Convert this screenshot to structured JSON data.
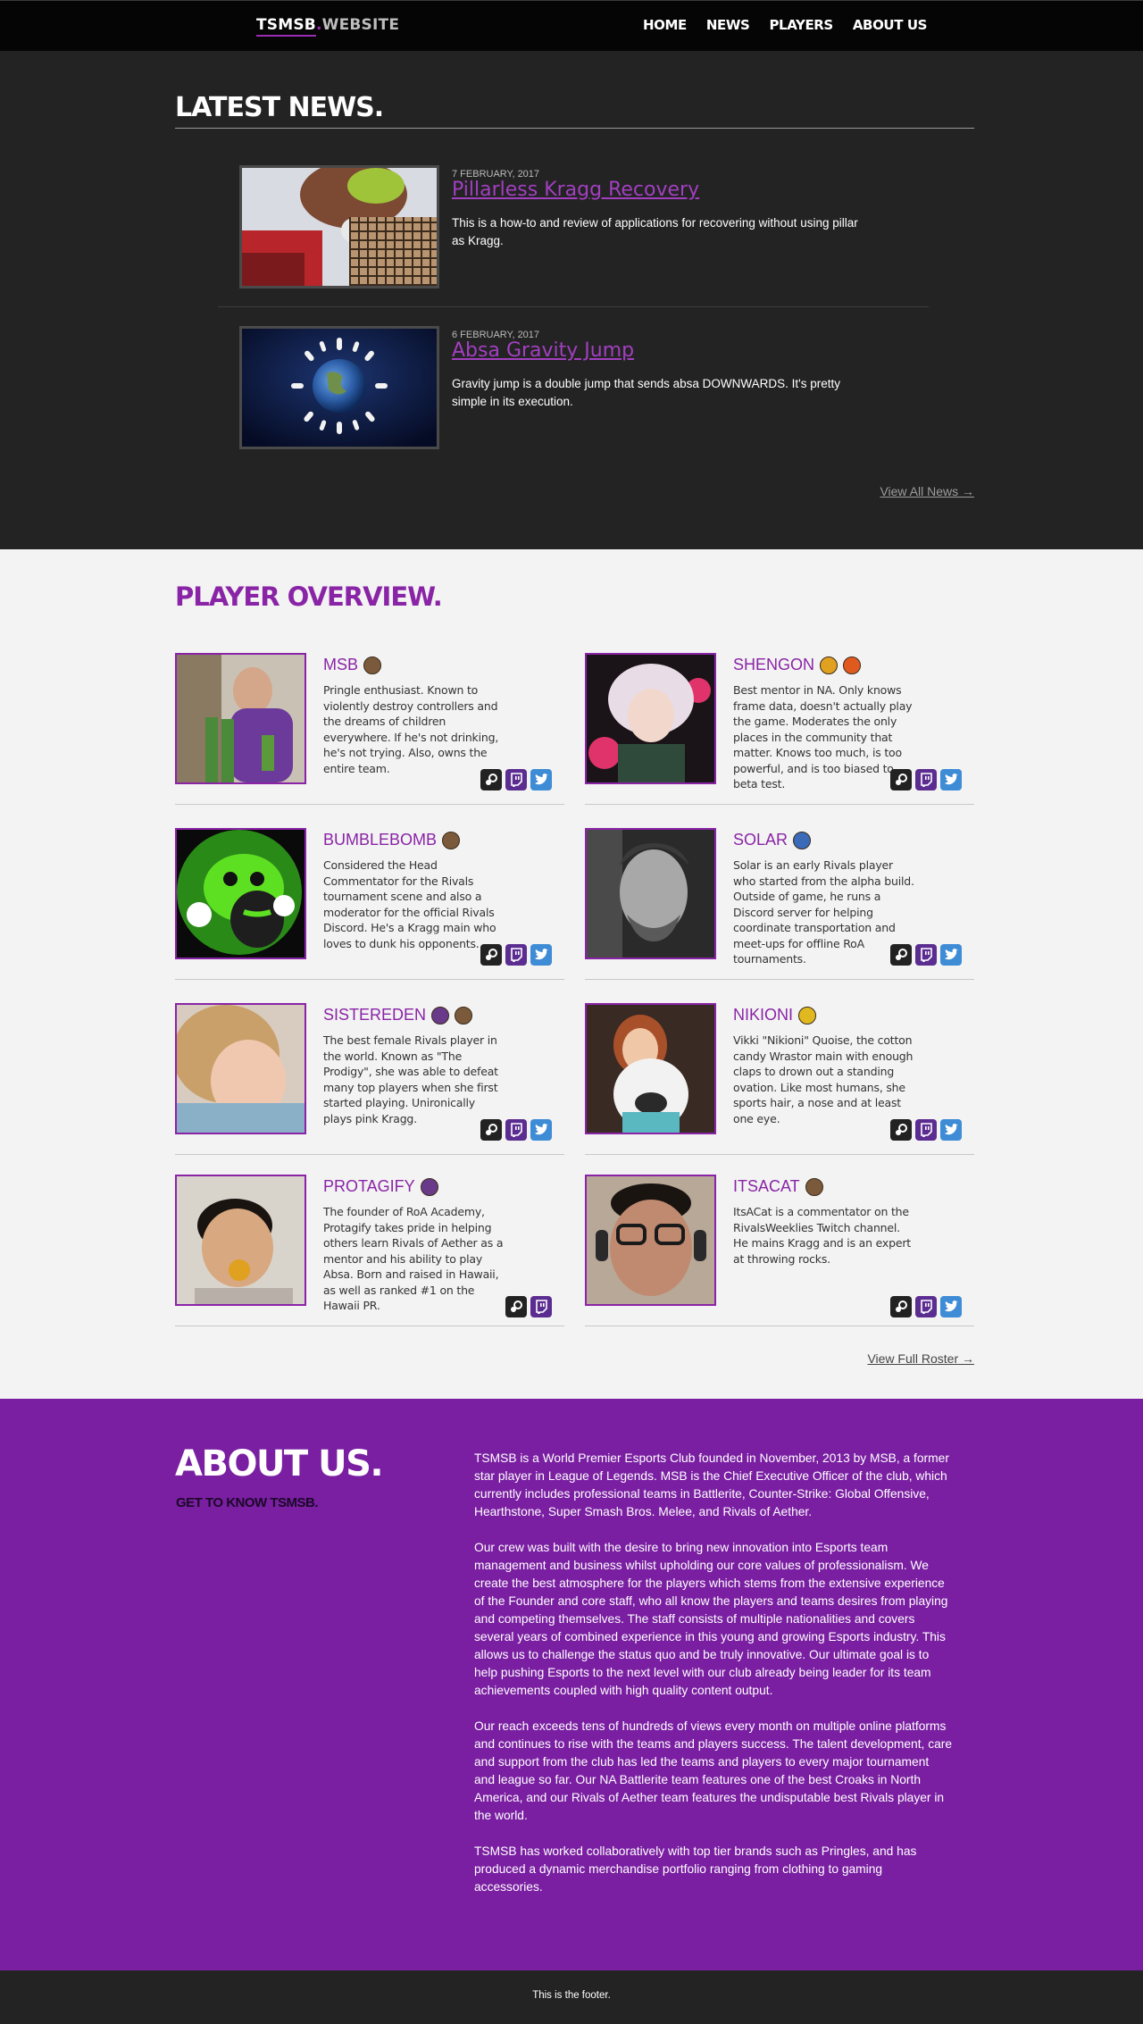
{
  "nav": {
    "brand_left": "TSMSB",
    "brand_dot": ".",
    "brand_right": "WEBSITE",
    "links": [
      "HOME",
      "NEWS",
      "PLAYERS",
      "ABOUT US"
    ]
  },
  "news": {
    "title": "LATEST NEWS.",
    "articles": [
      {
        "date": "7 FEBRUARY, 2017",
        "title": "Pillarless Kragg Recovery",
        "desc": "This is a how-to and review of applications for recovering without using pillar as Kragg."
      },
      {
        "date": "6 FEBRUARY, 2017",
        "title": "Absa Gravity Jump",
        "desc": "Gravity jump is a double jump that sends absa DOWNWARDS. It's pretty simple in its execution."
      }
    ],
    "view_all": "View All News →"
  },
  "players": {
    "title": "PLAYER OVERVIEW.",
    "list": [
      {
        "name": "MSB",
        "desc": "Pringle enthusiast. Known to violently destroy controllers and the dreams of children everywhere. If he's not drinking, he's not trying. Also, owns the entire team."
      },
      {
        "name": "SHENGON",
        "desc": "Best mentor in NA. Only knows frame data, doesn't actually play the game. Moderates the only places in the community that matter. Knows too much, is too powerful, and is too biased to beta test."
      },
      {
        "name": "BUMBLEBOMB",
        "desc": "Considered the Head Commentator for the Rivals tournament scene and also a moderator for the official Rivals Discord. He's a Kragg main who loves to dunk his opponents."
      },
      {
        "name": "SOLAR",
        "desc": "Solar is an early Rivals player who started from the alpha build. Outside of game, he runs a Discord server for helping coordinate transportation and meet-ups for offline RoA tournaments."
      },
      {
        "name": "SISTEREDEN",
        "desc": "The best female Rivals player in the world. Known as \"The Prodigy\", she was able to defeat many top players when she first started playing. Unironically plays pink Kragg."
      },
      {
        "name": "NIKIONI",
        "desc": "Vikki \"Nikioni\" Quoise, the cotton candy Wrastor main with enough claps to drown out a standing ovation. Like most humans, she sports hair, a nose and at least one eye."
      },
      {
        "name": "PROTAGIFY",
        "desc": "The founder of RoA Academy, Protagify takes pride in helping others learn Rivals of Aether as a mentor and his ability to play Absa. Born and raised in Hawaii, as well as ranked #1 on the Hawaii PR."
      },
      {
        "name": "ITSACAT",
        "desc": "ItsACat is a commentator on the RivalsWeeklies Twitch channel. He mains Kragg and is an expert at throwing rocks."
      }
    ],
    "view_roster": "View Full Roster →"
  },
  "about": {
    "title": "ABOUT US.",
    "subtitle": "GET TO KNOW TSMSB.",
    "paragraphs": [
      "TSMSB is a World Premier Esports Club founded in November, 2013 by MSB, a former star player in League of Legends. MSB is the Chief Executive Officer of the club, which currently includes professional teams in Battlerite, Counter-Strike: Global Offensive, Hearthstone, Super Smash Bros. Melee, and Rivals of Aether.",
      "Our crew was built with the desire to bring new innovation into Esports team management and business whilst upholding our core values of professionalism. We create the best atmosphere for the players which stems from the extensive experience of the Founder and core staff, who all know the players and teams desires from playing and competing themselves. The staff consists of multiple nationalities and covers several years of combined experience in this young and growing Esports industry. This allows us to challenge the status quo and be truly innovative. Our ultimate goal is to help pushing Esports to the next level with our club already being leader for its team achievements coupled with high quality content output.",
      "Our reach exceeds tens of hundreds of views every month on multiple online platforms and continues to rise with the teams and players success. The talent development, care and support from the club has led the teams and players to every major tournament and league so far. Our NA Battlerite team features one of the best Croaks in North America, and our Rivals of Aether team features the undisputable best Rivals player in the world.",
      "TSMSB has worked collaboratively with top tier brands such as Pringles, and has produced a dynamic merchandise portfolio ranging from clothing to gaming accessories."
    ]
  },
  "footer": {
    "text": "This is the footer."
  },
  "colors": {
    "accent": "#8a24a6",
    "about_bg": "#7a1fa2",
    "dark_bg": "#232323"
  }
}
